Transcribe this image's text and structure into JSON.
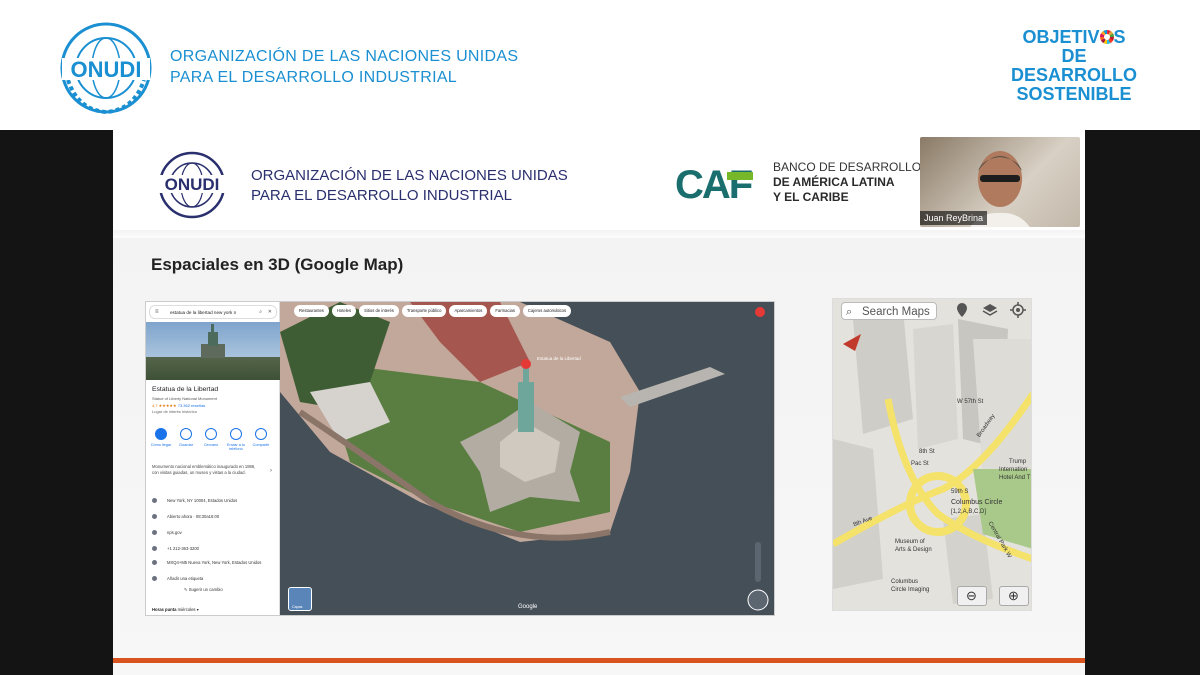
{
  "banner": {
    "onudi_logo_text": "ONUDI",
    "org_name_line1": "ORGANIZACIÓN DE LAS NACIONES UNIDAS",
    "org_name_line2": "PARA EL DESARROLLO INDUSTRIAL",
    "ods_line1_a": "OBJETIV",
    "ods_line1_b": "S",
    "ods_line2": "DE DESARROLLO",
    "ods_line3": "SOSTENIBLE"
  },
  "slide": {
    "onudi_logo_text": "ONUDI",
    "org_name_line1": "ORGANIZACIÓN DE LAS NACIONES UNIDAS",
    "org_name_line2": "PARA EL DESARROLLO INDUSTRIAL",
    "caf_logo_text": "CAF",
    "caf_line1": "BANCO DE DESARROLLO",
    "caf_line2": "DE AMÉRICA LATINA",
    "caf_line3": "Y EL CARIBE",
    "title": "Espaciales en 3D (Google Map)"
  },
  "webcam": {
    "participant_name": "Juan ReyBrina"
  },
  "google_maps": {
    "search_value": "estatua de la libertad new york n",
    "place_name": "Estatua de la Libertad",
    "place_subtitle": "Statue of Liberty National Monument",
    "rating": "4,7 ★★★★★",
    "reviews": "73.362 reseñas",
    "place_type": "Lugar de interés histórico",
    "actions": [
      "Cómo llegar",
      "Guardar",
      "Cercano",
      "Enviar a tu teléfono",
      "Compartir"
    ],
    "description": "Monumento nacional emblemático inaugurado en 1886, con visitas guiadas, un museo y vistas a la ciudad.",
    "address": "New York, NY 10004, Estados Unidos",
    "hours": "Abierto ahora · 08:30a16:00",
    "website": "nps.gov",
    "phone": "+1 212-363-3200",
    "plus_code": "MXQ4+M5 Nueva York, New York, Estados Unidos",
    "add_label": "Añadir una etiqueta",
    "suggest_edit": "Sugerir un cambio",
    "popular_times": "Horas punta",
    "popular_day": "miércoles ▾",
    "chips": [
      "Restaurantes",
      "Hoteles",
      "Sitios de interés",
      "Transporte público",
      "Aparcamientos",
      "Farmacias",
      "Cajeros automáticos"
    ],
    "map_pin_label": "Estatua de la Libertad",
    "watermark": "Google",
    "layers_label": "Capas"
  },
  "apple_maps": {
    "search_placeholder": "Search Maps",
    "labels": {
      "pac_st": "Pac St",
      "w59": "59th S",
      "columbus_circle": "Columbus Circle",
      "lines": "[1,2,A,B,C,D]",
      "trump": "Trump",
      "intl": "Internation",
      "hotel": "Hotel And T",
      "museum1": "Museum of",
      "museum2": "Arts & Design",
      "ccircle1": "Columbus",
      "ccircle2": "Circle Imaging",
      "bth_ave": "8th Ave",
      "broadway": "Broadway",
      "w_57": "W 57th St",
      "cpw": "Central Park W",
      "bth_st": "8th St"
    }
  },
  "colors": {
    "onudi_blue": "#1a8fd1",
    "slide_navy": "#2a2f6e",
    "caf_teal": "#1b6e6e",
    "caf_green": "#76b82a",
    "footer_orange": "#d9541e"
  }
}
